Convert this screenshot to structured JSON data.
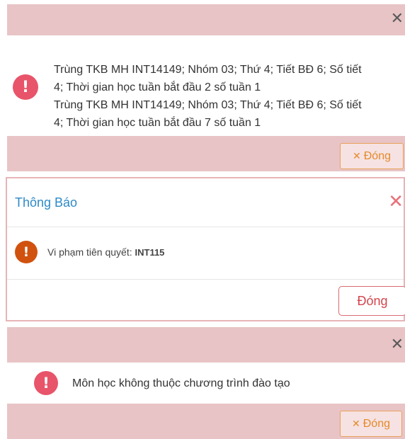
{
  "dialog1": {
    "message_lines": [
      "Trùng TKB MH INT14149; Nhóm 03; Thứ 4; Tiết BĐ 6; Số tiết",
      "4; Thời gian học tuần bắt đầu 2 số tuần 1",
      "Trùng TKB MH INT14149; Nhóm 03; Thứ 4; Tiết BĐ 6; Số tiết",
      "4; Thời gian học tuần bắt đầu 7 số tuần 1"
    ],
    "close_symbol": "✕",
    "close_button_icon": "✕",
    "close_button_label": "Đóng",
    "icon_glyph": "!"
  },
  "dialog2": {
    "title": "Thông Báo",
    "close_symbol": "✕",
    "message_label": "Vi phạm tiên quyết:",
    "message_value": "INT115",
    "icon_glyph": "!",
    "close_button_label": "Đóng"
  },
  "dialog3": {
    "message": "Môn học không thuộc chương trình đào tạo",
    "close_symbol": "✕",
    "close_button_icon": "✕",
    "close_button_label": "Đóng",
    "icon_glyph": "!"
  },
  "icons": {
    "dialog1_icon": "error-icon",
    "dialog2_icon": "warning-icon",
    "dialog3_icon": "error-icon"
  },
  "colors": {
    "bar_background": "#e8c4c6",
    "error_red": "#e8546a",
    "warning_orange": "#d0520e",
    "title_blue": "#2e8ac8",
    "button_orange": "#e58a2a",
    "button_red": "#d4454e"
  }
}
